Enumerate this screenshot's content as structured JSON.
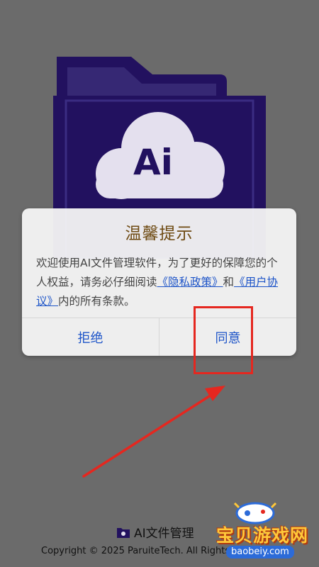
{
  "splash": {
    "logo_text": "Ai",
    "app_name": "AI文件管理",
    "copyright": "Copyright © 2025 ParuiteTech. All Rights Reserved"
  },
  "dialog": {
    "title": "温馨提示",
    "message_part1": "欢迎使用AI文件管理软件，为了更好的保障您的个人权益，请务必仔细阅读",
    "privacy_link": "《隐私政策》",
    "and_text": "和",
    "user_link": "《用户协议》",
    "message_part2": "内的所有条款。",
    "refuse_label": "拒绝",
    "agree_label": "同意"
  },
  "watermark": {
    "text": "宝贝游戏网",
    "url": "baobeiy.com"
  },
  "colors": {
    "logo_purple": "#22115f",
    "dialog_title": "#6e4a12",
    "link_blue": "#1d54c8",
    "annotation_red": "#e5271f"
  }
}
